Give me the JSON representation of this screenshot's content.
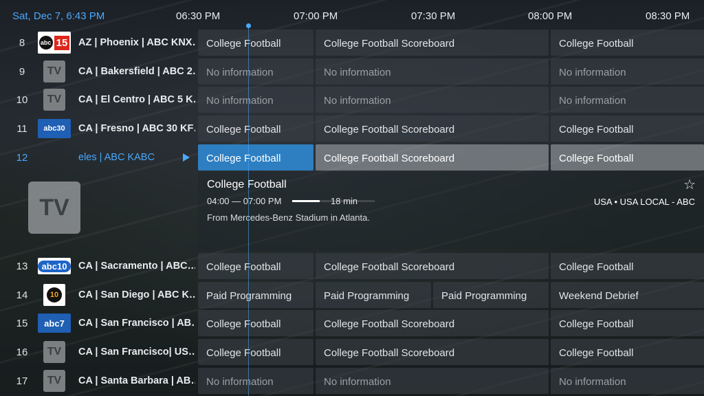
{
  "header": {
    "date_time": "Sat, Dec 7, 6:43 PM",
    "times": [
      "06:30 PM",
      "07:00 PM",
      "07:30 PM",
      "08:00 PM",
      "08:30 PM"
    ]
  },
  "channels": [
    {
      "num": "8",
      "logo": "abc15-logo",
      "name": "AZ | Phoenix | ABC KNX…",
      "programs": [
        {
          "title": "College Football"
        },
        {
          "title": "College Football Scoreboard"
        },
        {
          "title": "College Football"
        }
      ]
    },
    {
      "num": "9",
      "logo": "tv-logo",
      "name": "CA | Bakersfield | ABC 2…",
      "programs": [
        {
          "title": "No information"
        },
        {
          "title": "No information"
        },
        {
          "title": "No information"
        }
      ]
    },
    {
      "num": "10",
      "logo": "tv-logo",
      "name": "CA | El Centro | ABC 5 K…",
      "programs": [
        {
          "title": "No information"
        },
        {
          "title": "No information"
        },
        {
          "title": "No information"
        }
      ]
    },
    {
      "num": "11",
      "logo": "abc30-logo",
      "name": "CA | Fresno | ABC 30 KF…",
      "programs": [
        {
          "title": "College Football"
        },
        {
          "title": "College Football Scoreboard"
        },
        {
          "title": "College Football"
        }
      ]
    },
    {
      "num": "12",
      "logo": "tv-logo",
      "name": "eles | ABC KABC",
      "programs": [
        {
          "title": "College Football"
        },
        {
          "title": "College Football Scoreboard"
        },
        {
          "title": "College Football"
        }
      ]
    },
    {
      "num": "13",
      "logo": "abc10-logo",
      "name": "CA | Sacramento | ABC…",
      "programs": [
        {
          "title": "College Football"
        },
        {
          "title": "College Football Scoreboard"
        },
        {
          "title": "College Football"
        }
      ]
    },
    {
      "num": "14",
      "logo": "abc10-sd-logo",
      "name": "CA | San Diego | ABC  K…",
      "programs": [
        {
          "title": "Paid Programming"
        },
        {
          "title": "Paid Programming"
        },
        {
          "title": "Paid Programming"
        },
        {
          "title": "Weekend Debrief"
        }
      ]
    },
    {
      "num": "15",
      "logo": "abc7-logo",
      "name": "CA | San Francisco | AB…",
      "programs": [
        {
          "title": "College Football"
        },
        {
          "title": "College Football Scoreboard"
        },
        {
          "title": "College Football"
        }
      ]
    },
    {
      "num": "16",
      "logo": "tv-logo",
      "name": "CA | San Francisco| US…",
      "programs": [
        {
          "title": "College Football"
        },
        {
          "title": "College Football Scoreboard"
        },
        {
          "title": "College Football"
        }
      ]
    },
    {
      "num": "17",
      "logo": "tv-logo",
      "name": "CA | Santa Barbara | AB…",
      "programs": [
        {
          "title": "No information"
        },
        {
          "title": "No information"
        },
        {
          "title": "No information"
        }
      ]
    }
  ],
  "logos": {
    "abc_circle": "abc",
    "abc15_num": "15",
    "abc30_text": "abc30",
    "abc10_text": "abc10",
    "sd_text": "10",
    "abc7_text": "abc7",
    "tv_text": "TV"
  },
  "detail": {
    "title": "College Football",
    "time_range": "04:00 — 07:00 PM",
    "progress": 0.33,
    "remaining": "18 min",
    "description": "From Mercedes-Benz Stadium in Atlanta.",
    "meta": "USA  •  USA LOCAL - ABC",
    "logo_text": "TV"
  },
  "colors": {
    "accent": "#4aa8ff",
    "selected_cell": "#2e7fc1"
  }
}
